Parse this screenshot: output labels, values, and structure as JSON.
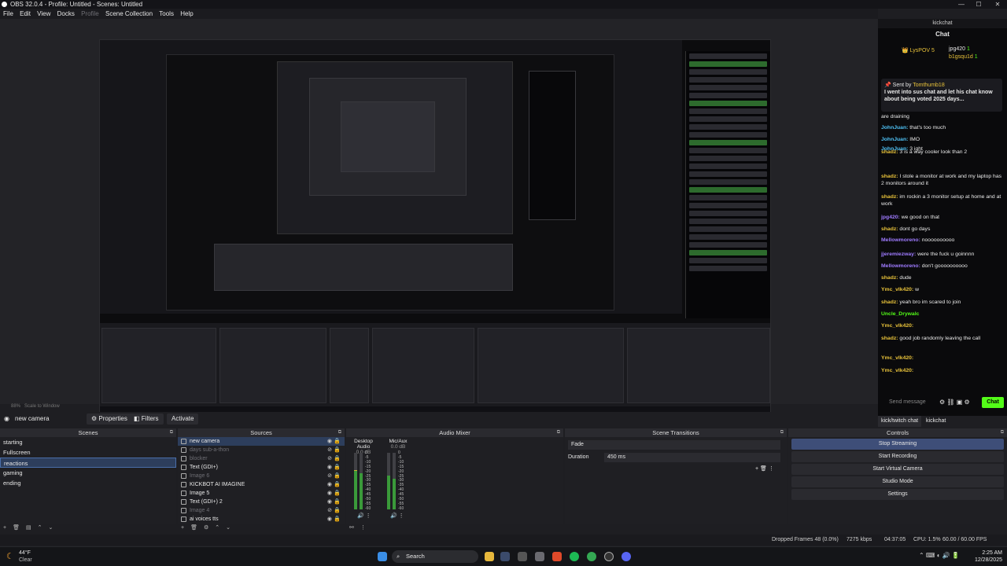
{
  "window": {
    "title": "OBS 32.0.4 - Profile: Untitled - Scenes: Untitled"
  },
  "menu": [
    "File",
    "Edit",
    "View",
    "Docks",
    "Profile",
    "Scene Collection",
    "Tools",
    "Help"
  ],
  "preview": {
    "zoom": "88%",
    "scale_label": "Scale to Window"
  },
  "toolbar": {
    "source_name": "new camera",
    "properties": "Properties",
    "filters": "Filters",
    "activate": "Activate"
  },
  "scenes": {
    "title": "Scenes",
    "items": [
      "starting",
      "Fullscreen",
      "reactions",
      "gaming",
      "ending"
    ],
    "selected": "reactions"
  },
  "sources": {
    "title": "Sources",
    "items": [
      "new camera",
      "days sub-a-thon",
      "blocker",
      "Text (GDI+)",
      "Image 6",
      "KICKBOT AI IMAGINE",
      "Image 5",
      "Text (GDI+) 2",
      "Image 4",
      "ai voices tts"
    ],
    "selected": "new camera"
  },
  "audio_mixer": {
    "title": "Audio Mixer",
    "channels": [
      {
        "name": "Desktop Audio",
        "db": "0.0 dB",
        "level": 0.7
      },
      {
        "name": "Mic/Aux",
        "db": "0.0 dB",
        "level": 0.6
      }
    ],
    "ticks": [
      "0",
      "-5",
      "-10",
      "-15",
      "-20",
      "-25",
      "-30",
      "-35",
      "-40",
      "-45",
      "-50",
      "-55",
      "-60"
    ]
  },
  "transitions": {
    "title": "Scene Transitions",
    "selected": "Fade",
    "duration_label": "Duration",
    "duration": "450 ms"
  },
  "controls": {
    "title": "Controls",
    "buttons": [
      "Stop Streaming",
      "Start Recording",
      "Start Virtual Camera",
      "Studio Mode",
      "Settings"
    ]
  },
  "status": {
    "dropped": "Dropped Frames 48 (0.0%)",
    "bitrate": "7275 kbps",
    "time": "04:37:05",
    "cpu": "CPU: 1.5%",
    "fps": "60.00 / 60.00 FPS"
  },
  "chat": {
    "dock_title": "kickchat",
    "title": "Chat",
    "badges": [
      {
        "name": "LysPOV",
        "count": "5"
      },
      {
        "name": "jpg420",
        "count": "1"
      },
      {
        "name": "b1gsqu1d",
        "count": "1"
      }
    ],
    "pinned_by": "Sent by",
    "pinned_user": "Tomthumb18",
    "pinned_text": "I went into sus chat and let his chat know about being voted 2025 days...",
    "messages": [
      {
        "user": "",
        "text": "are draining",
        "color": "#ffffff"
      },
      {
        "user": "JohnJuan:",
        "text": "that's too much",
        "color": "#4fc3f7"
      },
      {
        "user": "JohnJuan:",
        "text": "IMO",
        "color": "#4fc3f7"
      },
      {
        "user": "JohnJuan:",
        "text": "3 ight",
        "color": "#4fc3f7"
      },
      {
        "user": "shadz:",
        "text": "3 is a way cooler look than 2",
        "color": "#e8c23a"
      },
      {
        "user": "shadz:",
        "text": "I stole a monitor at work and my laptop has 2 monitors around it",
        "color": "#e8c23a"
      },
      {
        "user": "shadz:",
        "text": "im rockin a 3 monitor setup at home and at work",
        "color": "#e8c23a"
      },
      {
        "user": "jpg420:",
        "text": "we good on that",
        "color": "#9f7bff"
      },
      {
        "user": "shadz:",
        "text": "dont go days",
        "color": "#e8c23a"
      },
      {
        "user": "Mellowmoreno:",
        "text": "noooooooooo",
        "color": "#9f7bff"
      },
      {
        "user": "jjeremiezway:",
        "text": "were the fuck u goinnnn",
        "color": "#9f7bff"
      },
      {
        "user": "Mellowmoreno:",
        "text": "don't goooooooooo",
        "color": "#9f7bff"
      },
      {
        "user": "shadz:",
        "text": "dude",
        "color": "#e8c23a"
      },
      {
        "user": "Ymc_vlk420:",
        "text": "w",
        "color": "#e8c23a"
      },
      {
        "user": "shadz:",
        "text": "yeah bro im scared to join",
        "color": "#e8c23a"
      },
      {
        "user": "Uncle_Drywalc",
        "text": "",
        "color": "#53fc18"
      },
      {
        "user": "Ymc_vlk420:",
        "text": "",
        "color": "#e8c23a"
      },
      {
        "user": "shadz:",
        "text": "good job randomly leaving the call",
        "color": "#e8c23a"
      },
      {
        "user": "Ymc_vlk420:",
        "text": "",
        "color": "#e8c23a"
      },
      {
        "user": "Ymc_vlk420:",
        "text": "",
        "color": "#e8c23a"
      }
    ],
    "input_placeholder": "Send message",
    "send": "Chat",
    "tabs": [
      "kick/twitch chat",
      "kickchat"
    ]
  },
  "taskbar": {
    "weather_temp": "44°F",
    "weather_desc": "Clear",
    "search": "Search",
    "time": "2:25 AM",
    "date": "12/28/2025"
  }
}
